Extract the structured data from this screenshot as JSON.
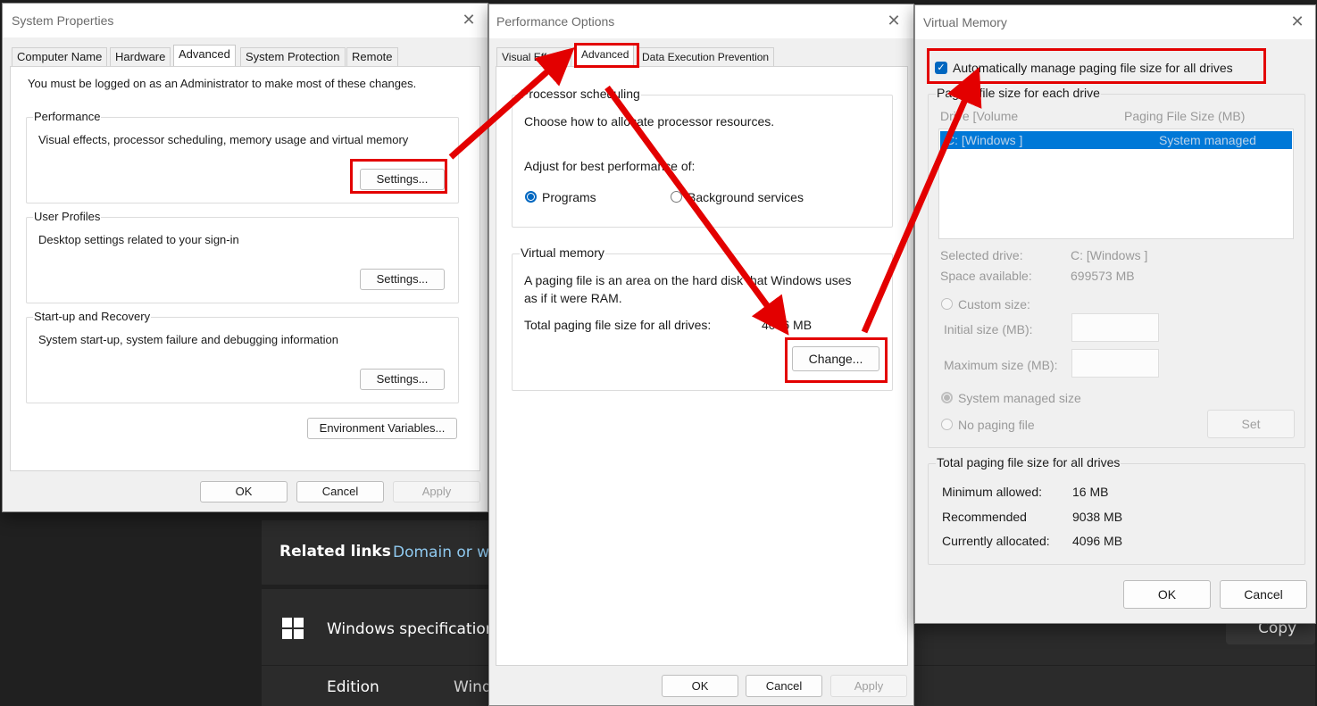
{
  "background": {
    "related_links": "Related links",
    "domain_link": "Domain or wo",
    "windows_specs": "Windows specifications",
    "copy": "Copy",
    "edition_label": "Edition",
    "edition_value": "Wind"
  },
  "system_properties": {
    "title": "System Properties",
    "tabs": [
      "Computer Name",
      "Hardware",
      "Advanced",
      "System Protection",
      "Remote"
    ],
    "admin_note": "You must be logged on as an Administrator to make most of these changes.",
    "performance": {
      "label": "Performance",
      "desc": "Visual effects, processor scheduling, memory usage and virtual memory",
      "button": "Settings..."
    },
    "user_profiles": {
      "label": "User Profiles",
      "desc": "Desktop settings related to your sign-in",
      "button": "Settings..."
    },
    "startup": {
      "label": "Start-up and Recovery",
      "desc": "System start-up, system failure and debugging information",
      "button": "Settings..."
    },
    "env_button": "Environment Variables...",
    "ok": "OK",
    "cancel": "Cancel",
    "apply": "Apply"
  },
  "performance_options": {
    "title": "Performance Options",
    "tabs": [
      "Visual Effects",
      "Advanced",
      "Data Execution Prevention"
    ],
    "processor": {
      "label": "Processor scheduling",
      "desc": "Choose how to allocate processor resources.",
      "adjust": "Adjust for best performance of:",
      "programs": "Programs",
      "background": "Background services"
    },
    "virtual_memory": {
      "label": "Virtual memory",
      "desc1": "A paging file is an area on the hard disk that Windows uses",
      "desc2": "as if it were RAM.",
      "total_label": "Total paging file size for all drives:",
      "total_value": "4096 MB",
      "change": "Change..."
    },
    "ok": "OK",
    "cancel": "Cancel",
    "apply": "Apply"
  },
  "virtual_memory": {
    "title": "Virtual Memory",
    "auto_manage": "Automatically manage paging file size for all drives",
    "each_drive_label": "Paging file size for each drive",
    "col_drive": "Drive  [Volume",
    "col_size": "Paging File Size (MB)",
    "row_drive": "C:    [Windows ]",
    "row_size": "System managed",
    "selected_drive_label": "Selected drive:",
    "selected_drive_value": "C:  [Windows ]",
    "space_label": "Space available:",
    "space_value": "699573 MB",
    "custom_size": "Custom size:",
    "initial_size": "Initial size (MB):",
    "maximum_size": "Maximum size (MB):",
    "system_managed": "System managed size",
    "no_paging": "No paging file",
    "set": "Set",
    "total_label": "Total paging file size for all drives",
    "min_label": "Minimum allowed:",
    "min_value": "16 MB",
    "rec_label": "Recommended",
    "rec_value": "9038 MB",
    "cur_label": "Currently allocated:",
    "cur_value": "4096 MB",
    "ok": "OK",
    "cancel": "Cancel"
  },
  "colors": {
    "annotation_red": "#e30000",
    "accent_blue": "#0067c0",
    "selection_blue": "#0078d7"
  }
}
